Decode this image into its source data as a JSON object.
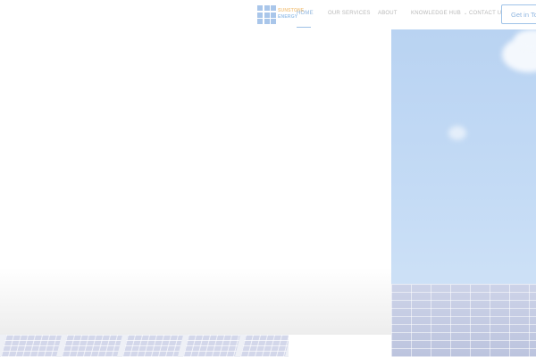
{
  "brand": {
    "logo_line1": "SUNSTONE",
    "logo_line2": "ENERGY"
  },
  "nav": {
    "items": [
      {
        "label": "HOME",
        "active": true
      },
      {
        "label": "OUR SERVICES",
        "active": false
      },
      {
        "label": "ABOUT",
        "active": false
      },
      {
        "label": "KNOWLEDGE HUB",
        "active": false,
        "has_dropdown": true,
        "dropdown_icon": "chevron-down-icon"
      },
      {
        "label": "CONTACT US",
        "active": false
      }
    ]
  },
  "cta": {
    "label": "Get in To"
  },
  "colors": {
    "accent": "#8fb4dc",
    "nav_text": "#b9b9b9",
    "logo_orange": "#f3c98b",
    "logo_blue": "#a9c6ea"
  }
}
